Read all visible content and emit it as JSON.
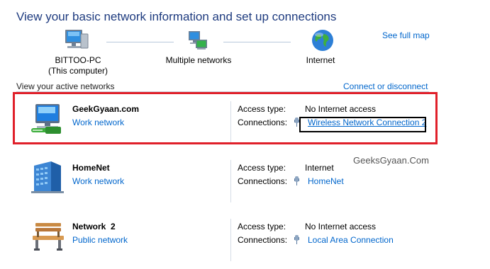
{
  "header": {
    "title": "View your basic network information and set up connections",
    "see_full_map": "See full map"
  },
  "map": {
    "computer_name": "BITTOO-PC",
    "computer_sub": "(This computer)",
    "middle": "Multiple networks",
    "internet": "Internet"
  },
  "active": {
    "label": "View your active networks",
    "connect_link": "Connect or disconnect"
  },
  "networks": [
    {
      "name": "GeekGyaan.com",
      "type": "Work network",
      "access_label": "Access type:",
      "access_value": "No Internet access",
      "conn_label": "Connections:",
      "conn_value": "Wireless Network Connection 2",
      "icon": "work-network-icon"
    },
    {
      "name": "HomeNet",
      "type": "Work network",
      "access_label": "Access type:",
      "access_value": "Internet",
      "conn_label": "Connections:",
      "conn_value": "HomeNet",
      "icon": "building-icon"
    },
    {
      "name": "Network  2",
      "type": "Public network",
      "access_label": "Access type:",
      "access_value": "No Internet access",
      "conn_label": "Connections:",
      "conn_value": "Local Area Connection",
      "icon": "park-bench-icon"
    }
  ],
  "watermark": "GeeksGyaan.Com",
  "colors": {
    "title": "#1e3b7f",
    "link": "#0066cc",
    "highlight": "#e0202a"
  }
}
